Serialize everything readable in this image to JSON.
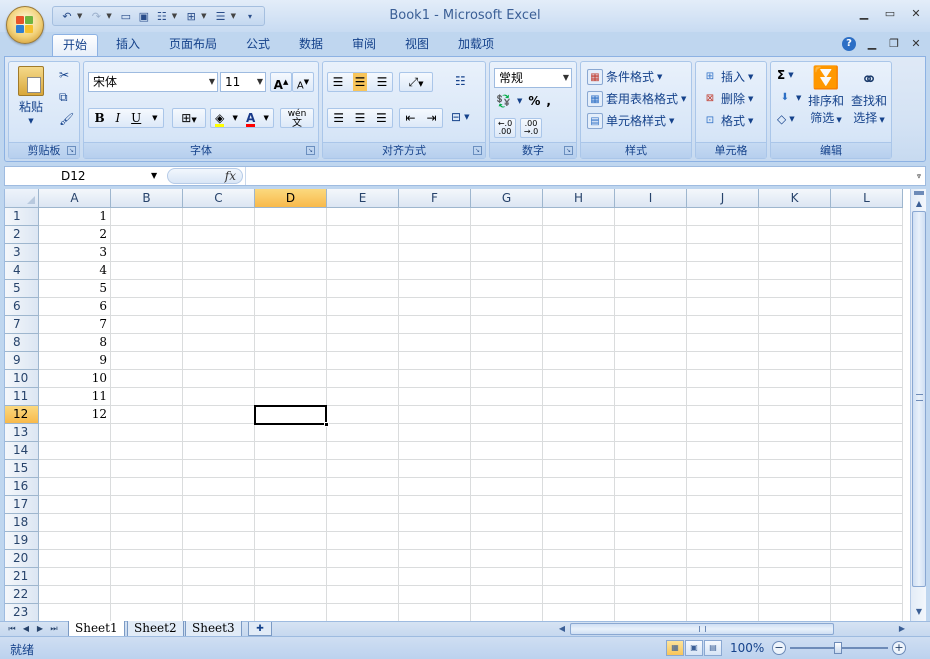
{
  "window": {
    "title": "Book1 - Microsoft Excel"
  },
  "ribbon": {
    "tabs": [
      {
        "label": "开始",
        "active": true
      },
      {
        "label": "插入"
      },
      {
        "label": "页面布局"
      },
      {
        "label": "公式"
      },
      {
        "label": "数据"
      },
      {
        "label": "审阅"
      },
      {
        "label": "视图"
      },
      {
        "label": "加载项"
      }
    ],
    "clipboard": {
      "paste_label": "粘贴",
      "group_label": "剪贴板"
    },
    "font": {
      "font_name": "宋体",
      "font_size": "11",
      "group_label": "字体",
      "bold": "B",
      "italic": "I",
      "underline": "U",
      "grow": "A",
      "shrink": "A",
      "phonetic": "wén"
    },
    "alignment": {
      "group_label": "对齐方式"
    },
    "number": {
      "format": "常规",
      "percent": "%",
      "comma": ",",
      "group_label": "数字"
    },
    "styles": {
      "conditional": "条件格式",
      "table": "套用表格格式",
      "cell_styles": "单元格样式",
      "group_label": "样式"
    },
    "cells": {
      "insert": "插入",
      "delete": "删除",
      "format": "格式",
      "group_label": "单元格"
    },
    "editing": {
      "sort_filter_1": "排序和",
      "sort_filter_2": "筛选",
      "find_select_1": "查找和",
      "find_select_2": "选择",
      "group_label": "编辑"
    }
  },
  "formula_bar": {
    "name_box": "D12",
    "fx": "fx",
    "content": ""
  },
  "grid": {
    "columns": [
      "A",
      "B",
      "C",
      "D",
      "E",
      "F",
      "G",
      "H",
      "I",
      "J",
      "K",
      "L"
    ],
    "rows": [
      "1",
      "2",
      "3",
      "4",
      "5",
      "6",
      "7",
      "8",
      "9",
      "10",
      "11",
      "12",
      "13",
      "14",
      "15",
      "16",
      "17",
      "18",
      "19",
      "20",
      "21",
      "22",
      "23"
    ],
    "column_a_values": [
      "1",
      "2",
      "3",
      "4",
      "5",
      "6",
      "7",
      "8",
      "9",
      "10",
      "11",
      "12"
    ],
    "active_cell": "D12"
  },
  "sheets": {
    "tabs": [
      "Sheet1",
      "Sheet2",
      "Sheet3"
    ],
    "active": "Sheet1"
  },
  "status": {
    "ready": "就绪",
    "zoom": "100%"
  }
}
